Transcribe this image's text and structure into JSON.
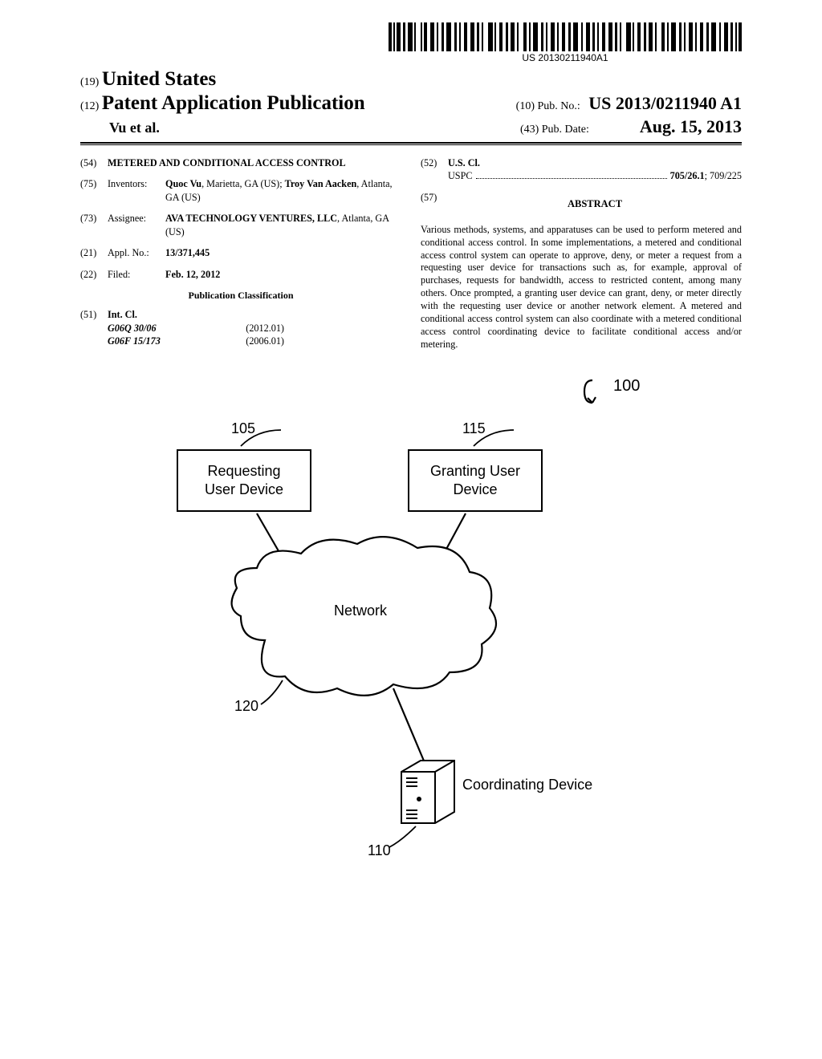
{
  "barcode_text": "US 20130211940A1",
  "header": {
    "country_num": "(19)",
    "country": "United States",
    "kind_num": "(12)",
    "kind": "Patent Application Publication",
    "authors": "Vu et al.",
    "pubno_num": "(10)",
    "pubno_label": "Pub. No.:",
    "pubno_value": "US 2013/0211940 A1",
    "pubdate_num": "(43)",
    "pubdate_label": "Pub. Date:",
    "pubdate_value": "Aug. 15, 2013"
  },
  "biblio": {
    "title_num": "(54)",
    "title": "METERED AND CONDITIONAL ACCESS CONTROL",
    "inventors_num": "(75)",
    "inventors_label": "Inventors:",
    "inventors_html": "Quoc Vu, Marietta, GA (US); Troy Van Aacken, Atlanta, GA (US)",
    "inventor1_name": "Quoc Vu",
    "inventor1_rest": ", Marietta, GA (US); ",
    "inventor2_name": "Troy Van Aacken",
    "inventor2_rest": ", Atlanta, GA (US)",
    "assignee_num": "(73)",
    "assignee_label": "Assignee:",
    "assignee_name": "AVA TECHNOLOGY VENTURES, LLC",
    "assignee_rest": ", Atlanta, GA (US)",
    "applno_num": "(21)",
    "applno_label": "Appl. No.:",
    "applno_value": "13/371,445",
    "filed_num": "(22)",
    "filed_label": "Filed:",
    "filed_value": "Feb. 12, 2012",
    "pubclass_heading": "Publication Classification",
    "intcl_num": "(51)",
    "intcl_label": "Int. Cl.",
    "intcl1_code": "G06Q 30/06",
    "intcl1_year": "(2012.01)",
    "intcl2_code": "G06F 15/173",
    "intcl2_year": "(2006.01)",
    "uscl_num": "(52)",
    "uscl_label": "U.S. Cl.",
    "uscl_prefix": "USPC",
    "uscl_value": "705/26.1; 709/225",
    "abstract_num": "(57)",
    "abstract_heading": "ABSTRACT",
    "abstract_text": "Various methods, systems, and apparatuses can be used to perform metered and conditional access control. In some implementations, a metered and conditional access control system can operate to approve, deny, or meter a request from a requesting user device for transactions such as, for example, approval of purchases, requests for bandwidth, access to restricted content, among many others. Once prompted, a granting user device can grant, deny, or meter directly with the requesting user device or another network element. A metered and conditional access control system can also coordinate with a metered conditional access control coordinating device to facilitate conditional access and/or metering."
  },
  "diagram": {
    "ref_100": "100",
    "ref_105": "105",
    "ref_115": "115",
    "ref_120": "120",
    "ref_110": "110",
    "box1_line1": "Requesting",
    "box1_line2": "User Device",
    "box2_line1": "Granting User",
    "box2_line2": "Device",
    "network_label": "Network",
    "coord_label": "Coordinating Device"
  }
}
